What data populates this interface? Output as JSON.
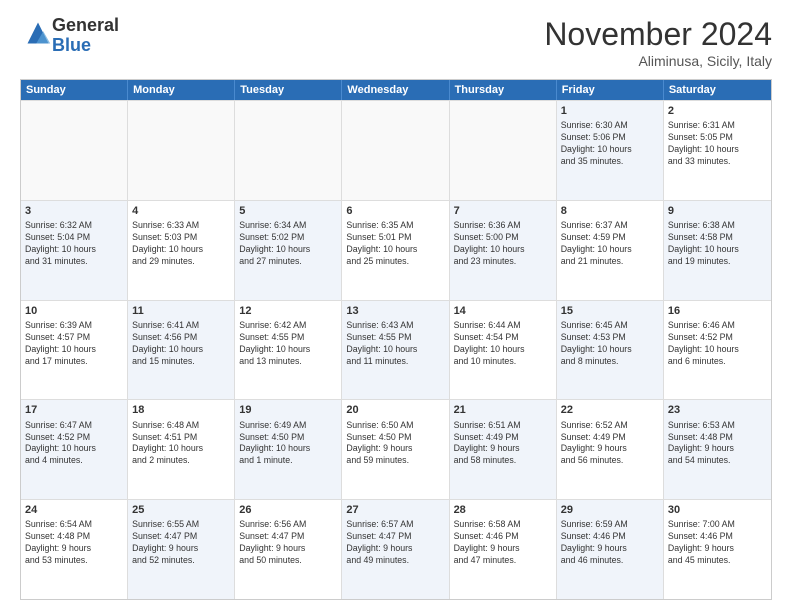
{
  "logo": {
    "general": "General",
    "blue": "Blue"
  },
  "header": {
    "month": "November 2024",
    "location": "Aliminusa, Sicily, Italy"
  },
  "days": [
    "Sunday",
    "Monday",
    "Tuesday",
    "Wednesday",
    "Thursday",
    "Friday",
    "Saturday"
  ],
  "rows": [
    [
      {
        "day": "",
        "info": "",
        "empty": true
      },
      {
        "day": "",
        "info": "",
        "empty": true
      },
      {
        "day": "",
        "info": "",
        "empty": true
      },
      {
        "day": "",
        "info": "",
        "empty": true
      },
      {
        "day": "",
        "info": "",
        "empty": true
      },
      {
        "day": "1",
        "info": "Sunrise: 6:30 AM\nSunset: 5:06 PM\nDaylight: 10 hours\nand 35 minutes.",
        "shaded": true
      },
      {
        "day": "2",
        "info": "Sunrise: 6:31 AM\nSunset: 5:05 PM\nDaylight: 10 hours\nand 33 minutes.",
        "shaded": false
      }
    ],
    [
      {
        "day": "3",
        "info": "Sunrise: 6:32 AM\nSunset: 5:04 PM\nDaylight: 10 hours\nand 31 minutes.",
        "shaded": true
      },
      {
        "day": "4",
        "info": "Sunrise: 6:33 AM\nSunset: 5:03 PM\nDaylight: 10 hours\nand 29 minutes.",
        "shaded": false
      },
      {
        "day": "5",
        "info": "Sunrise: 6:34 AM\nSunset: 5:02 PM\nDaylight: 10 hours\nand 27 minutes.",
        "shaded": true
      },
      {
        "day": "6",
        "info": "Sunrise: 6:35 AM\nSunset: 5:01 PM\nDaylight: 10 hours\nand 25 minutes.",
        "shaded": false
      },
      {
        "day": "7",
        "info": "Sunrise: 6:36 AM\nSunset: 5:00 PM\nDaylight: 10 hours\nand 23 minutes.",
        "shaded": true
      },
      {
        "day": "8",
        "info": "Sunrise: 6:37 AM\nSunset: 4:59 PM\nDaylight: 10 hours\nand 21 minutes.",
        "shaded": false
      },
      {
        "day": "9",
        "info": "Sunrise: 6:38 AM\nSunset: 4:58 PM\nDaylight: 10 hours\nand 19 minutes.",
        "shaded": true
      }
    ],
    [
      {
        "day": "10",
        "info": "Sunrise: 6:39 AM\nSunset: 4:57 PM\nDaylight: 10 hours\nand 17 minutes.",
        "shaded": false
      },
      {
        "day": "11",
        "info": "Sunrise: 6:41 AM\nSunset: 4:56 PM\nDaylight: 10 hours\nand 15 minutes.",
        "shaded": true
      },
      {
        "day": "12",
        "info": "Sunrise: 6:42 AM\nSunset: 4:55 PM\nDaylight: 10 hours\nand 13 minutes.",
        "shaded": false
      },
      {
        "day": "13",
        "info": "Sunrise: 6:43 AM\nSunset: 4:55 PM\nDaylight: 10 hours\nand 11 minutes.",
        "shaded": true
      },
      {
        "day": "14",
        "info": "Sunrise: 6:44 AM\nSunset: 4:54 PM\nDaylight: 10 hours\nand 10 minutes.",
        "shaded": false
      },
      {
        "day": "15",
        "info": "Sunrise: 6:45 AM\nSunset: 4:53 PM\nDaylight: 10 hours\nand 8 minutes.",
        "shaded": true
      },
      {
        "day": "16",
        "info": "Sunrise: 6:46 AM\nSunset: 4:52 PM\nDaylight: 10 hours\nand 6 minutes.",
        "shaded": false
      }
    ],
    [
      {
        "day": "17",
        "info": "Sunrise: 6:47 AM\nSunset: 4:52 PM\nDaylight: 10 hours\nand 4 minutes.",
        "shaded": true
      },
      {
        "day": "18",
        "info": "Sunrise: 6:48 AM\nSunset: 4:51 PM\nDaylight: 10 hours\nand 2 minutes.",
        "shaded": false
      },
      {
        "day": "19",
        "info": "Sunrise: 6:49 AM\nSunset: 4:50 PM\nDaylight: 10 hours\nand 1 minute.",
        "shaded": true
      },
      {
        "day": "20",
        "info": "Sunrise: 6:50 AM\nSunset: 4:50 PM\nDaylight: 9 hours\nand 59 minutes.",
        "shaded": false
      },
      {
        "day": "21",
        "info": "Sunrise: 6:51 AM\nSunset: 4:49 PM\nDaylight: 9 hours\nand 58 minutes.",
        "shaded": true
      },
      {
        "day": "22",
        "info": "Sunrise: 6:52 AM\nSunset: 4:49 PM\nDaylight: 9 hours\nand 56 minutes.",
        "shaded": false
      },
      {
        "day": "23",
        "info": "Sunrise: 6:53 AM\nSunset: 4:48 PM\nDaylight: 9 hours\nand 54 minutes.",
        "shaded": true
      }
    ],
    [
      {
        "day": "24",
        "info": "Sunrise: 6:54 AM\nSunset: 4:48 PM\nDaylight: 9 hours\nand 53 minutes.",
        "shaded": false
      },
      {
        "day": "25",
        "info": "Sunrise: 6:55 AM\nSunset: 4:47 PM\nDaylight: 9 hours\nand 52 minutes.",
        "shaded": true
      },
      {
        "day": "26",
        "info": "Sunrise: 6:56 AM\nSunset: 4:47 PM\nDaylight: 9 hours\nand 50 minutes.",
        "shaded": false
      },
      {
        "day": "27",
        "info": "Sunrise: 6:57 AM\nSunset: 4:47 PM\nDaylight: 9 hours\nand 49 minutes.",
        "shaded": true
      },
      {
        "day": "28",
        "info": "Sunrise: 6:58 AM\nSunset: 4:46 PM\nDaylight: 9 hours\nand 47 minutes.",
        "shaded": false
      },
      {
        "day": "29",
        "info": "Sunrise: 6:59 AM\nSunset: 4:46 PM\nDaylight: 9 hours\nand 46 minutes.",
        "shaded": true
      },
      {
        "day": "30",
        "info": "Sunrise: 7:00 AM\nSunset: 4:46 PM\nDaylight: 9 hours\nand 45 minutes.",
        "shaded": false
      }
    ]
  ]
}
